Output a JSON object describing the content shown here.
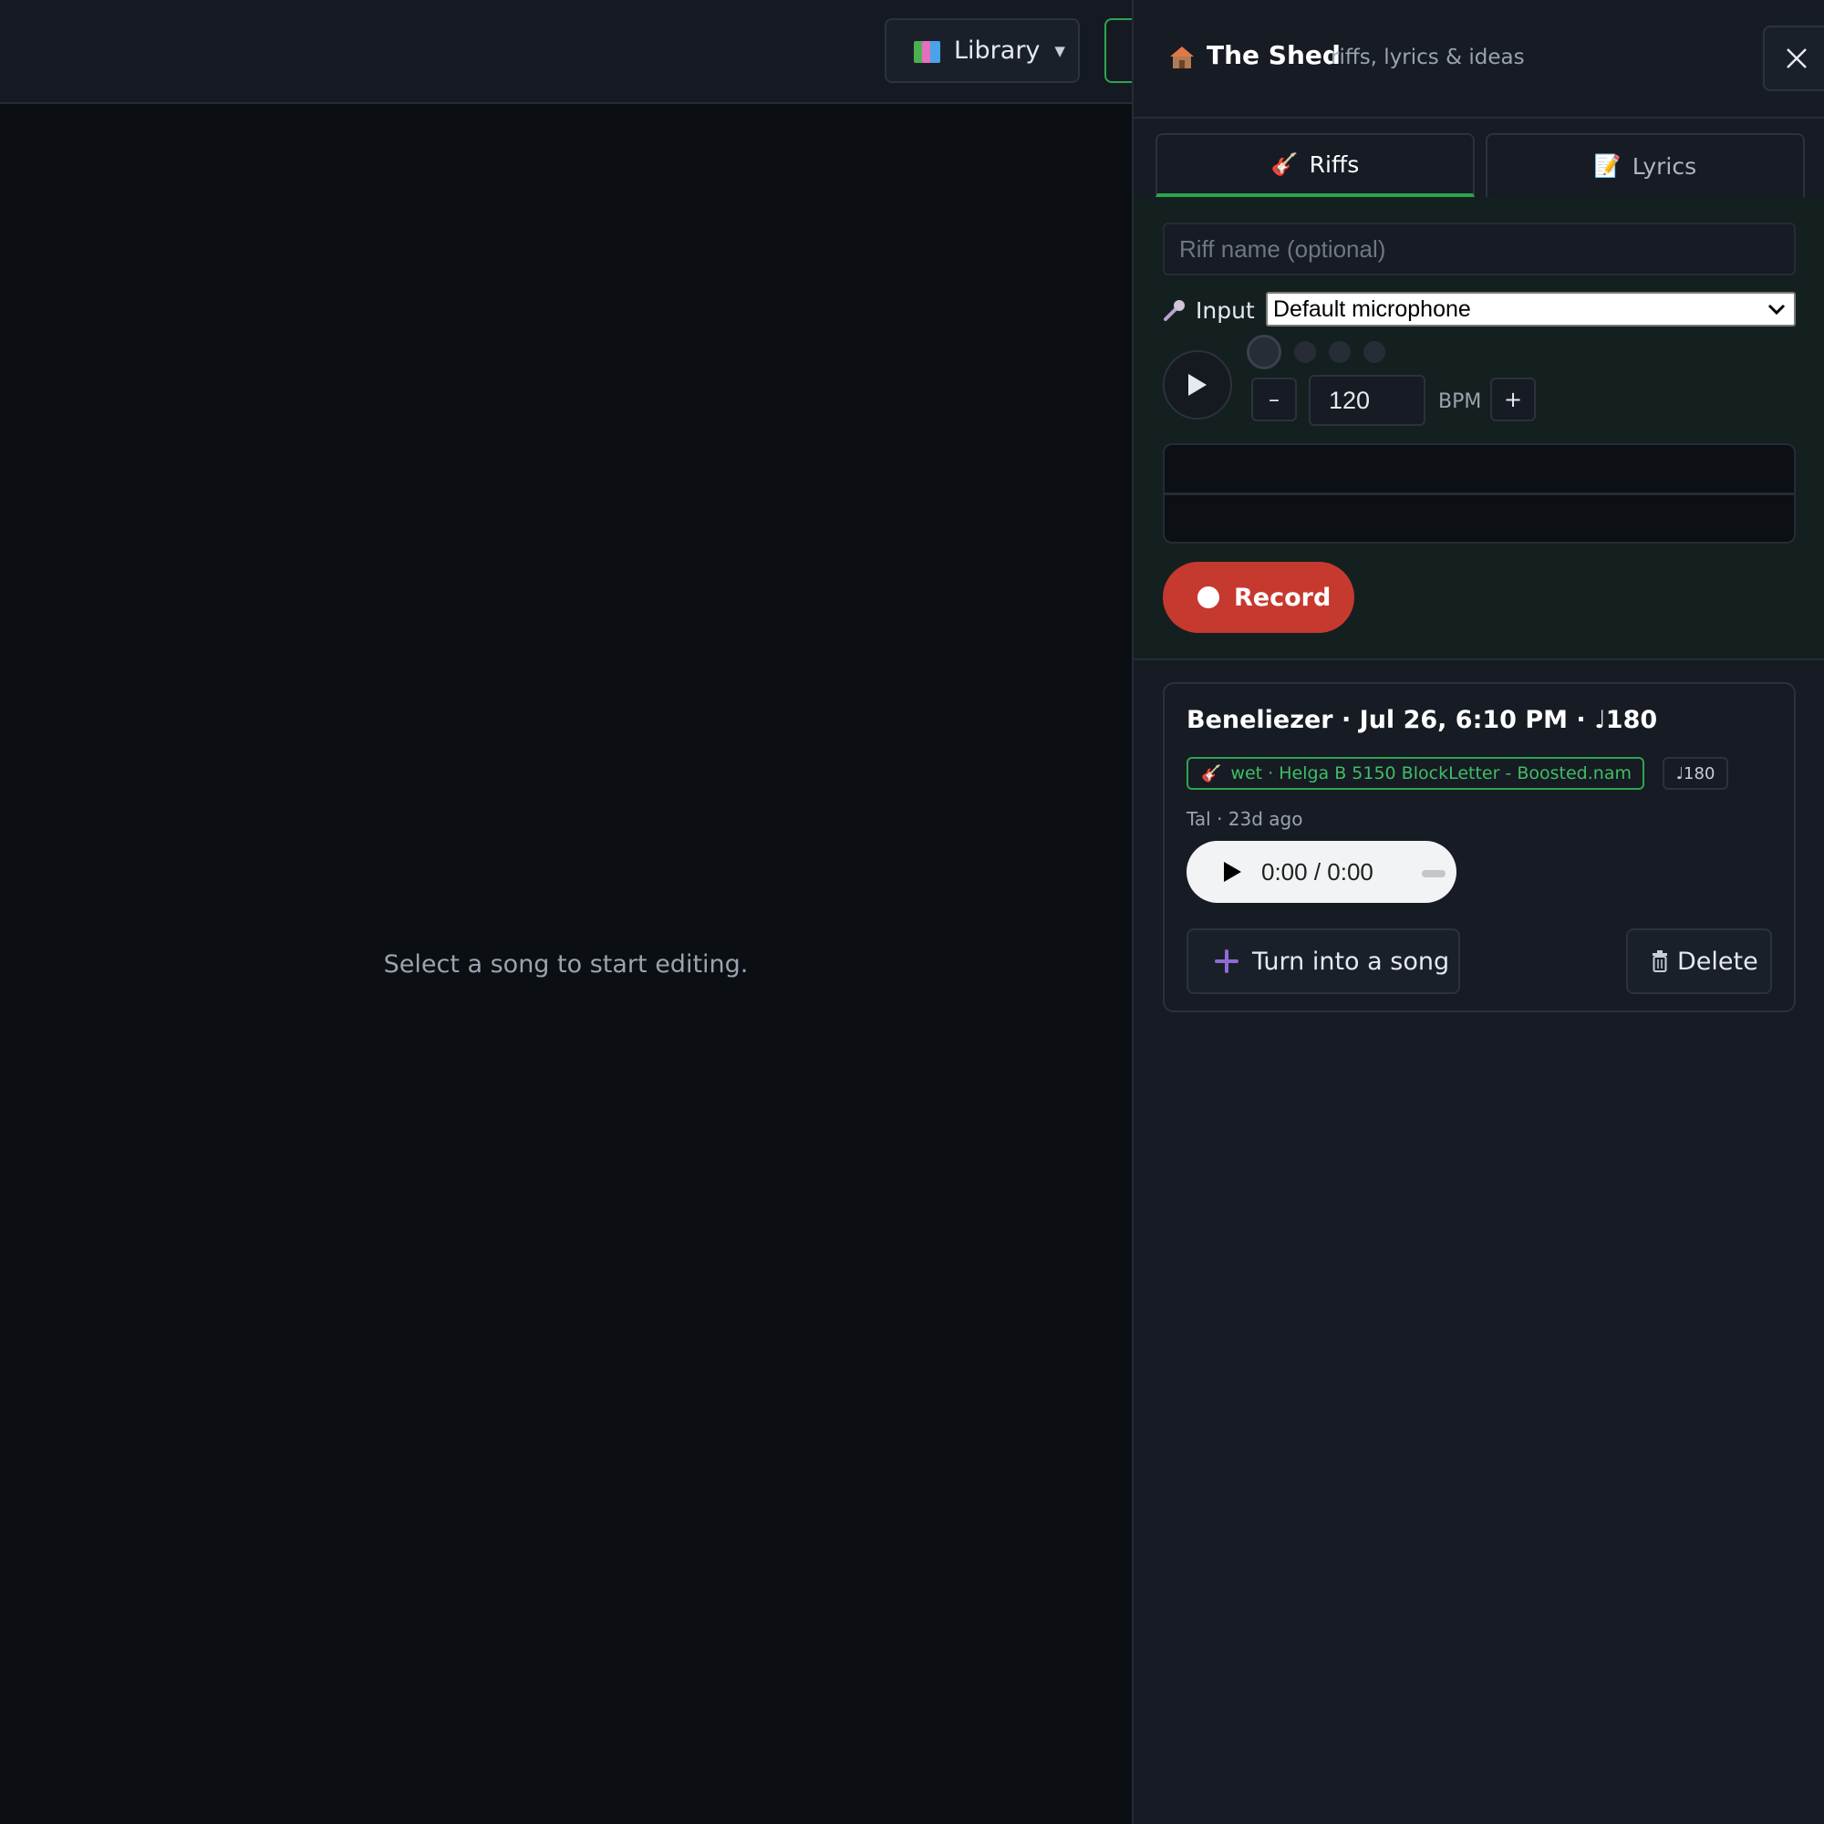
{
  "topbar": {
    "library_label": "Library",
    "library_caret": "▼"
  },
  "main": {
    "empty_message": "Select a song to start editing."
  },
  "panel": {
    "title": "The Shed",
    "subtitle": "riffs, lyrics & ideas",
    "tabs": [
      {
        "label": "Riffs",
        "icon": "🎸",
        "active": true
      },
      {
        "label": "Lyrics",
        "icon": "📝",
        "active": false
      }
    ],
    "recorder": {
      "riff_name_placeholder": "Riff name (optional)",
      "input_label": "Input",
      "input_selected": "Default microphone",
      "bpm_minus": "–",
      "bpm_value": "120",
      "bpm_unit": "BPM",
      "bpm_plus": "+",
      "record_label": "Record"
    },
    "riffs": [
      {
        "title": "Beneliezer · Jul 26, 6:10 PM · ♩180",
        "tone_badge": "wet · Helga B 5150 BlockLetter - Boosted.nam",
        "bpm_badge": "♩180",
        "meta": "Tal · 23d ago",
        "player_time": "0:00 / 0:00",
        "turn_into_song_label": "Turn into a song",
        "delete_label": "Delete"
      }
    ]
  },
  "colors": {
    "accent_green": "#2ea44f",
    "record_red": "#c6392e",
    "panel_bg": "#161b24",
    "main_bg": "#0b0e12"
  }
}
